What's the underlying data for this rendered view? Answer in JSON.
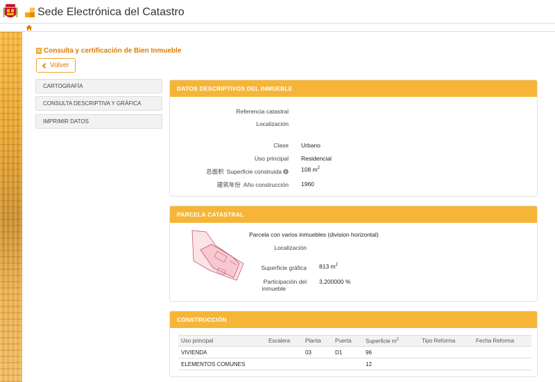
{
  "app": {
    "title": "Sede Electrónica del Catastro"
  },
  "icons": {
    "crest": "spain-crest-icon",
    "logo": "catastro-logo-icon",
    "home": "home-icon",
    "back": "chevron-left-icon",
    "info": "info-icon",
    "doc": "document-icon"
  },
  "colors": {
    "accent": "#f7b538",
    "accent_text": "#e07b00"
  },
  "page": {
    "title": "Consulta y certificación de Bien Inmueble",
    "back_label": "Volver"
  },
  "menu": [
    {
      "label": "CARTOGRAFÍA"
    },
    {
      "label": "CONSULTA DESCRIPTIVA Y GRÁFICA"
    },
    {
      "label": "IMPRIMIR DATOS"
    }
  ],
  "descriptive": {
    "header": "DATOS DESCRIPTIVOS DEL INMUEBLE",
    "ref_label": "Referencia catastral",
    "loc_label": "Localización",
    "clase_label": "Clase",
    "clase_value": "Urbano",
    "uso_label": "Uso principal",
    "uso_value": "Residencial",
    "sup_annot": "总面积",
    "sup_label": "Superficie construida",
    "sup_value": "108 m",
    "sup_unit_sup": "2",
    "anio_annot": "建筑年份",
    "anio_label": "Año construcción",
    "anio_value": "1960"
  },
  "parcel": {
    "header": "PARCELA CATASTRAL",
    "desc": "Parcela con varios inmuebles (division horizontal)",
    "loc_label": "Localización",
    "sup_label": "Superficie gráfica",
    "sup_value": "813 m",
    "sup_unit_sup": "2",
    "part_label_1": "Participación del",
    "part_label_2": "inmueble",
    "part_value": "3,200000 %"
  },
  "construction": {
    "header": "CONSTRUCCIÓN",
    "columns": [
      "Uso principal",
      "Escalera",
      "Planta",
      "Puerta",
      "Superficie m",
      "Tipo Reforma",
      "Fecha Reforma"
    ],
    "sup_col_sup": "2",
    "rows": [
      [
        "VIVIENDA",
        "",
        "03",
        "D1",
        "96",
        "",
        ""
      ],
      [
        "ELEMENTOS COMUNES",
        "",
        "",
        "",
        "12",
        "",
        ""
      ]
    ]
  }
}
